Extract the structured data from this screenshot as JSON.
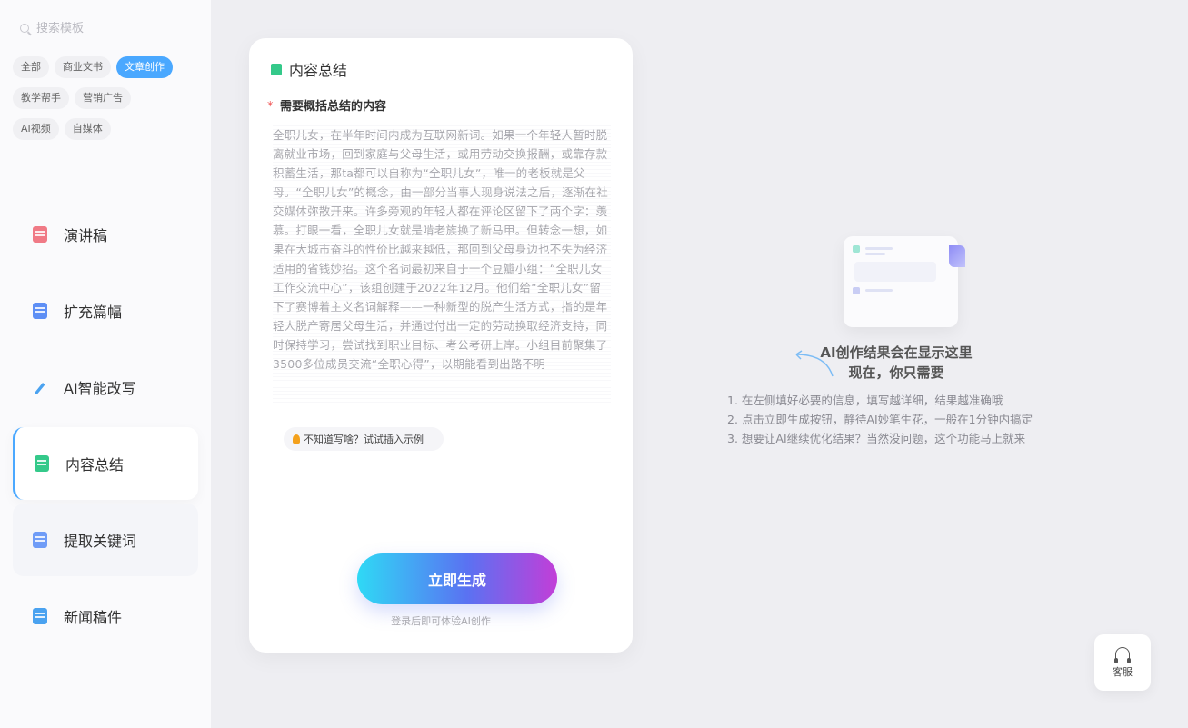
{
  "search": {
    "placeholder": "搜索模板"
  },
  "categories": [
    [
      "全部",
      "商业文书",
      "文章创作"
    ],
    [
      "教学帮手",
      "营销广告"
    ],
    [
      "AI视频",
      "自媒体"
    ]
  ],
  "active_category": "文章创作",
  "menu": [
    {
      "label": "演讲稿",
      "icon": "speech-doc-icon",
      "color": "#f07a86"
    },
    {
      "label": "扩充篇幅",
      "icon": "expand-doc-icon",
      "color": "#5e8ff5"
    },
    {
      "label": "AI智能改写",
      "icon": "pen-icon",
      "color": "#4aa2f0"
    },
    {
      "label": "内容总结",
      "icon": "summary-doc-icon",
      "color": "#34c98a",
      "active": true
    },
    {
      "label": "提取关键词",
      "icon": "keyword-doc-icon",
      "color": "#6f9cf7"
    },
    {
      "label": "新闻稿件",
      "icon": "news-doc-icon",
      "color": "#4aa2f0"
    }
  ],
  "panel": {
    "title": "内容总结",
    "field_required_mark": "*",
    "field_label": "需要概括总结的内容",
    "textarea_value": "全职儿女，在半年时间内成为互联网新词。如果一个年轻人暂时脱离就业市场，回到家庭与父母生活，或用劳动交换报酬，或靠存款积蓄生活，那ta都可以自称为“全职儿女”，唯一的老板就是父母。“全职儿女”的概念，由一部分当事人现身说法之后，逐渐在社交媒体弥散开来。许多旁观的年轻人都在评论区留下了两个字：羡慕。打眼一看，全职儿女就是啃老族换了新马甲。但转念一想，如果在大城市奋斗的性价比越来越低，那回到父母身边也不失为经济适用的省钱妙招。这个名词最初来自于一个豆瓣小组：“全职儿女工作交流中心”，该组创建于2022年12月。他们给“全职儿女”留下了赛博着主义名词解释——一种新型的脱产生活方式，指的是年轻人脱产寄居父母生活，并通过付出一定的劳动换取经济支持，同时保持学习，尝试找到职业目标、考公考研上岸。小组目前聚集了3500多位成员交流“全职心得”，以期能看到出路不明",
    "hint": "不知道写啥？试试插入示例",
    "generate_button": "立即生成",
    "login_note": "登录后即可体验AI创作"
  },
  "result": {
    "line1": "AI创作结果会在显示这里",
    "line2": "现在，你只需要",
    "steps": [
      "1. 在左侧填好必要的信息，填写越详细，结果越准确哦",
      "2. 点击立即生成按钮，静待AI妙笔生花，一般在1分钟内搞定",
      "3. 想要让AI继续优化结果？当然没问题，这个功能马上就来"
    ]
  },
  "customer_service": {
    "label": "客服"
  },
  "colors": {
    "accent": "#4aa8ff",
    "background": "#eeeef2",
    "panel": "#ffffff"
  }
}
